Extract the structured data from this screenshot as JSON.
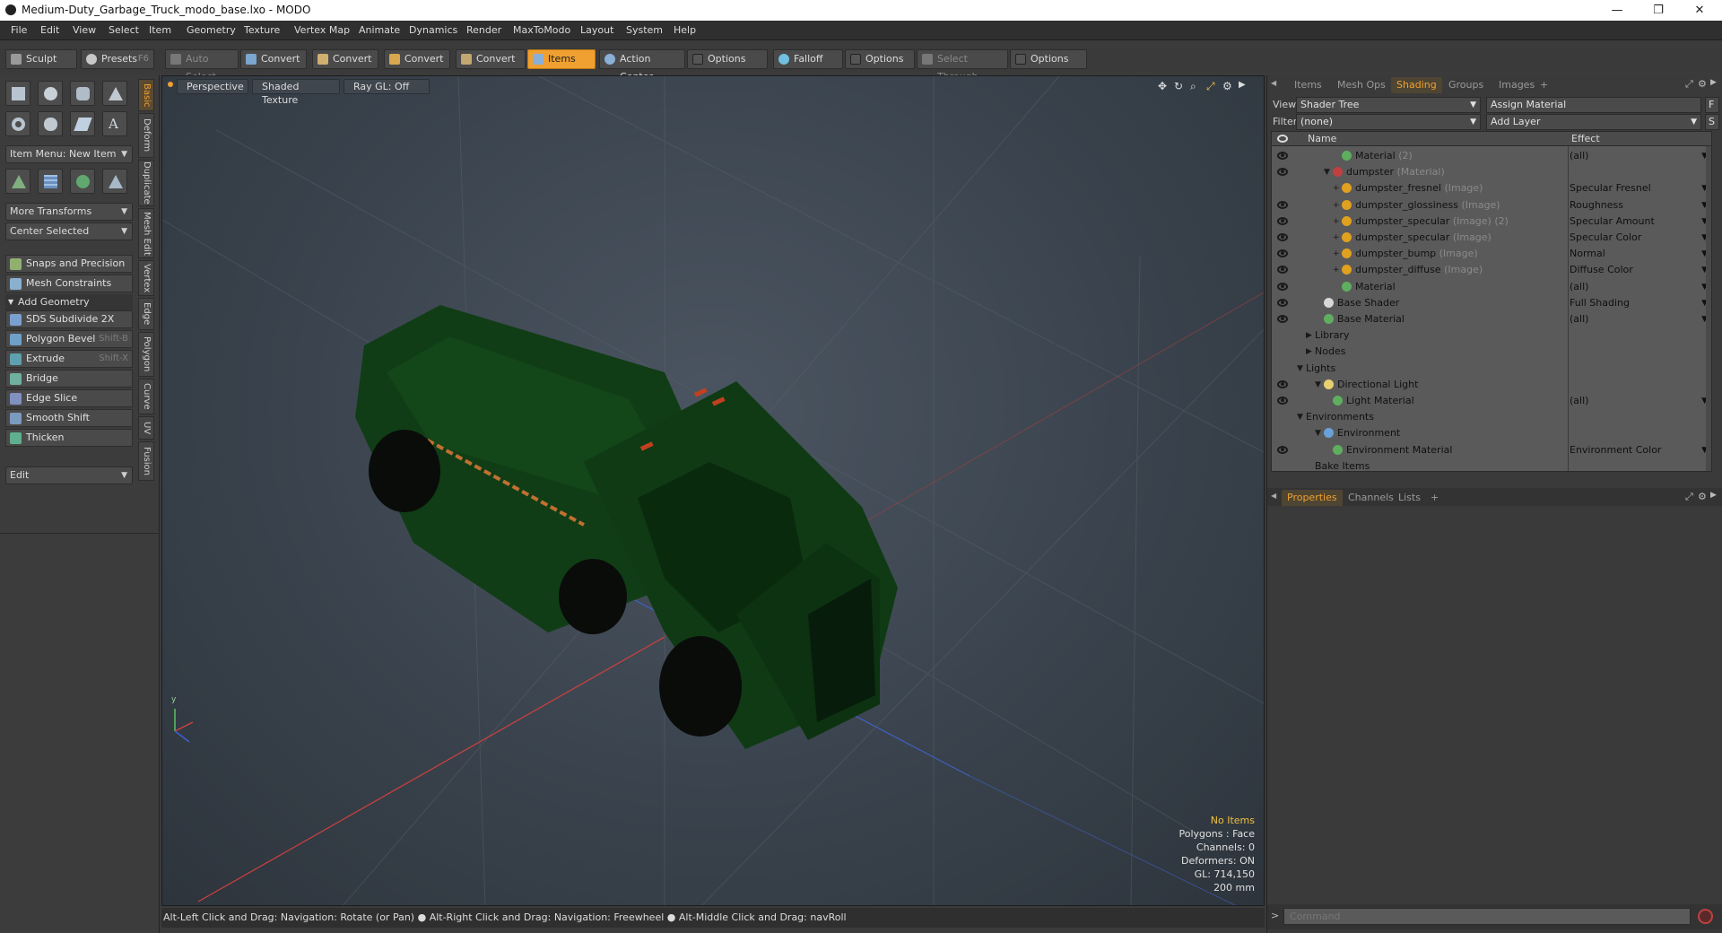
{
  "window": {
    "title": "Medium-Duty_Garbage_Truck_modo_base.lxo - MODO",
    "controls": [
      "—",
      "❐",
      "✕"
    ]
  },
  "menu": [
    "File",
    "Edit",
    "View",
    "Select",
    "Item",
    "Geometry",
    "Texture",
    "Vertex Map",
    "Animate",
    "Dynamics",
    "Render",
    "MaxToModo",
    "Layout",
    "System",
    "Help"
  ],
  "toolbar": {
    "sculpt": "Sculpt",
    "presets": "Presets",
    "presets_key": "F6",
    "auto_select": "Auto Select",
    "convert1": "Convert",
    "convert2": "Convert",
    "convert3": "Convert",
    "convert4": "Convert",
    "items": "Items",
    "action_center": "Action Center",
    "options1": "Options",
    "falloff": "Falloff",
    "options2": "Options",
    "select_through": "Select Through",
    "options3": "Options"
  },
  "left_panel": {
    "item_menu": "Item Menu: New Item",
    "more_transforms": "More Transforms",
    "center_selected": "Center Selected",
    "snaps": "Snaps and Precision",
    "mesh_constraints": "Mesh Constraints",
    "add_geometry": "Add Geometry",
    "tools": [
      {
        "label": "SDS Subdivide 2X",
        "key": "",
        "color": "#7aa0d0"
      },
      {
        "label": "Polygon Bevel",
        "key": "Shift-B",
        "color": "#6fa0c8"
      },
      {
        "label": "Extrude",
        "key": "Shift-X",
        "color": "#5fa0b0"
      },
      {
        "label": "Bridge",
        "key": "",
        "color": "#70b0a0"
      },
      {
        "label": "Edge Slice",
        "key": "",
        "color": "#8090c0"
      },
      {
        "label": "Smooth Shift",
        "key": "",
        "color": "#7a9ac0"
      },
      {
        "label": "Thicken",
        "key": "",
        "color": "#60b090"
      }
    ],
    "edit_dropdown": "Edit",
    "vertical_tabs": [
      "Basic",
      "Deform",
      "Duplicate",
      "Mesh Edit",
      "Vertex",
      "Edge",
      "Polygon",
      "Curve",
      "UV",
      "Fusion"
    ]
  },
  "viewport": {
    "view_mode": "Perspective",
    "shading": "Shaded Texture",
    "ray_gl": "Ray GL: Off",
    "stats": {
      "items": "No Items",
      "polygons": "Polygons : Face",
      "channels": "Channels: 0",
      "deformers": "Deformers: ON",
      "gl": "GL: 714,150",
      "scale": "200 mm"
    },
    "axis_labels": {
      "y": "y"
    }
  },
  "status_bar": "Alt-Left Click and Drag: Navigation: Rotate (or Pan) ● Alt-Right Click and Drag: Navigation: Freewheel ● Alt-Middle Click and Drag: navRoll",
  "right_panel": {
    "tabs": [
      "Items",
      "Mesh Ops",
      "Shading",
      "Groups",
      "Images",
      "+"
    ],
    "active_tab": "Shading",
    "view_label": "View",
    "view_value": "Shader Tree",
    "assign_material": "Assign Material",
    "f_button": "F",
    "filter_label": "Filter",
    "filter_value": "(none)",
    "add_layer": "Add Layer",
    "s_button": "S",
    "columns": {
      "name": "Name",
      "effect": "Effect"
    },
    "rows": [
      {
        "name": "Material",
        "sub": "(2)",
        "effect": "(all)",
        "indent": 5,
        "ball": "#5fae5f",
        "eye": true,
        "twist": ""
      },
      {
        "name": "dumpster",
        "sub": "(Material)",
        "effect": "",
        "indent": 4,
        "ball": "#c04040",
        "eye": true,
        "twist": "▼"
      },
      {
        "name": "dumpster_fresnel",
        "sub": "(Image)",
        "effect": "Specular Fresnel",
        "indent": 5,
        "ball": "#e0a020",
        "eye": false,
        "twist": "+"
      },
      {
        "name": "dumpster_glossiness",
        "sub": "(Image)",
        "effect": "Roughness",
        "indent": 5,
        "ball": "#e0a020",
        "eye": true,
        "twist": "+"
      },
      {
        "name": "dumpster_specular",
        "sub": "(Image) (2)",
        "effect": "Specular Amount",
        "indent": 5,
        "ball": "#e0a020",
        "eye": true,
        "twist": "+"
      },
      {
        "name": "dumpster_specular",
        "sub": "(Image)",
        "effect": "Specular Color",
        "indent": 5,
        "ball": "#e0a020",
        "eye": true,
        "twist": "+"
      },
      {
        "name": "dumpster_bump",
        "sub": "(Image)",
        "effect": "Normal",
        "indent": 5,
        "ball": "#e0a020",
        "eye": true,
        "twist": "+"
      },
      {
        "name": "dumpster_diffuse",
        "sub": "(Image)",
        "effect": "Diffuse Color",
        "indent": 5,
        "ball": "#e0a020",
        "eye": true,
        "twist": "+"
      },
      {
        "name": "Material",
        "sub": "",
        "effect": "(all)",
        "indent": 5,
        "ball": "#5fae5f",
        "eye": true,
        "twist": ""
      },
      {
        "name": "Base Shader",
        "sub": "",
        "effect": "Full Shading",
        "indent": 3,
        "ball": "#d8d8d8",
        "eye": true,
        "twist": ""
      },
      {
        "name": "Base Material",
        "sub": "",
        "effect": "(all)",
        "indent": 3,
        "ball": "#5fae5f",
        "eye": true,
        "twist": ""
      },
      {
        "name": "Library",
        "sub": "",
        "effect": "",
        "indent": 2,
        "ball": "",
        "eye": false,
        "twist": "▶"
      },
      {
        "name": "Nodes",
        "sub": "",
        "effect": "",
        "indent": 2,
        "ball": "",
        "eye": false,
        "twist": "▶"
      },
      {
        "name": "Lights",
        "sub": "",
        "effect": "",
        "indent": 1,
        "ball": "",
        "eye": false,
        "twist": "▼"
      },
      {
        "name": "Directional Light",
        "sub": "",
        "effect": "",
        "indent": 3,
        "ball": "#e8d070",
        "eye": true,
        "twist": "▼"
      },
      {
        "name": "Light Material",
        "sub": "",
        "effect": "(all)",
        "indent": 4,
        "ball": "#5fae5f",
        "eye": true,
        "twist": ""
      },
      {
        "name": "Environments",
        "sub": "",
        "effect": "",
        "indent": 1,
        "ball": "",
        "eye": false,
        "twist": "▼"
      },
      {
        "name": "Environment",
        "sub": "",
        "effect": "",
        "indent": 3,
        "ball": "#6aa0d8",
        "eye": false,
        "twist": "▼"
      },
      {
        "name": "Environment Material",
        "sub": "",
        "effect": "Environment Color",
        "indent": 4,
        "ball": "#5fae5f",
        "eye": true,
        "twist": ""
      },
      {
        "name": "Bake Items",
        "sub": "",
        "effect": "",
        "indent": 2,
        "ball": "",
        "eye": false,
        "twist": ""
      }
    ],
    "lower_tabs": [
      "Properties",
      "Channels",
      "Lists",
      "+"
    ],
    "lower_active": "Properties",
    "command_placeholder": "Command"
  },
  "colors": {
    "accent": "#f0a030",
    "truck_green": "#0f3a14"
  }
}
